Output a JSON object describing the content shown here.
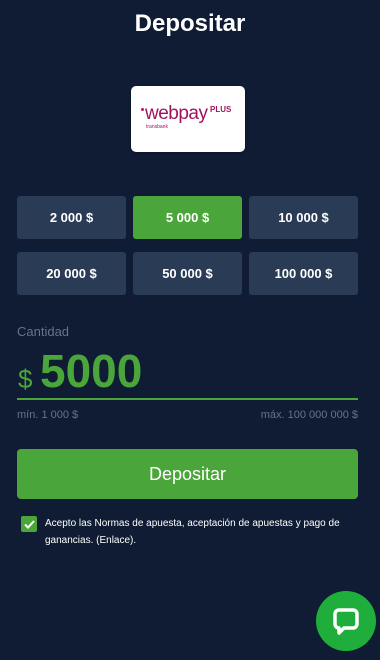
{
  "page": {
    "title": "Depositar",
    "background_color": "#0f1c33",
    "accent_color": "#4aa53a"
  },
  "payment_method": {
    "logo_text": "webpay",
    "logo_plus": "PLUS",
    "logo_subtext": "transbank",
    "brand_color": "#a0145e"
  },
  "amount_options": [
    {
      "label": "2 000 $",
      "selected": false
    },
    {
      "label": "5 000 $",
      "selected": true
    },
    {
      "label": "10 000 $",
      "selected": false
    },
    {
      "label": "20 000 $",
      "selected": false
    },
    {
      "label": "50 000 $",
      "selected": false
    },
    {
      "label": "100 000 $",
      "selected": false
    }
  ],
  "amount": {
    "label": "Cantidad",
    "currency_symbol": "$",
    "value": "5000",
    "min_label": "mín. 1 000 $",
    "max_label": "máx. 100 000 000 $"
  },
  "deposit_button": {
    "label": "Depositar"
  },
  "terms": {
    "checked": true,
    "text": "Acepto las Normas de apuesta, aceptación de apuestas y pago de ganancias. (Enlace)."
  },
  "chat": {
    "icon": "chat-bubble-icon",
    "color": "#1fae3b"
  }
}
